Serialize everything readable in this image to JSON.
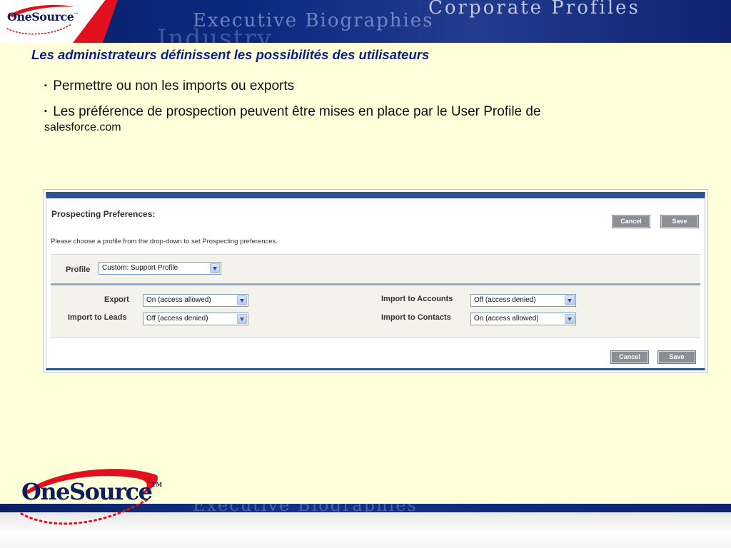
{
  "header": {
    "brand": "OneSource",
    "brand_tm": "™",
    "banner_words": [
      "Corporate Profiles",
      "Executive Biographies",
      "Industry"
    ]
  },
  "slide": {
    "title": "Les administrateurs définissent les possibilités des utilisateurs",
    "bullets": [
      {
        "text": "Permettre ou non les imports ou exports"
      },
      {
        "text": "Les préférence de prospection peuvent être mises en place par le User Profile de",
        "tail": "salesforce.com"
      }
    ],
    "bullet_marker": "▪"
  },
  "panel": {
    "title": "Prospecting Preferences:",
    "cancel_label": "Cancel",
    "save_label": "Save",
    "description": "Please choose a profile from the drop-down to set Prospecting preferences.",
    "profile": {
      "label": "Profile",
      "value": "Custom: Support Profile"
    },
    "fields": [
      {
        "label": "Export",
        "value": "On (access allowed)"
      },
      {
        "label": "Import to Leads",
        "value": "Off (access denied)"
      },
      {
        "label": "Import to Accounts",
        "value": "Off (access denied)"
      },
      {
        "label": "Import to Contacts",
        "value": "On (access allowed)"
      }
    ]
  },
  "footer": {
    "brand": "OneSource",
    "brand_tm": "TM",
    "banner_word": "Executive Biographies"
  },
  "colors": {
    "slide_background": "#ffffd9",
    "title_blue": "#0b1f8c",
    "banner_navy": "#0b1f66",
    "brand_red": "#e0101f",
    "panel_accent": "#2a5494"
  }
}
